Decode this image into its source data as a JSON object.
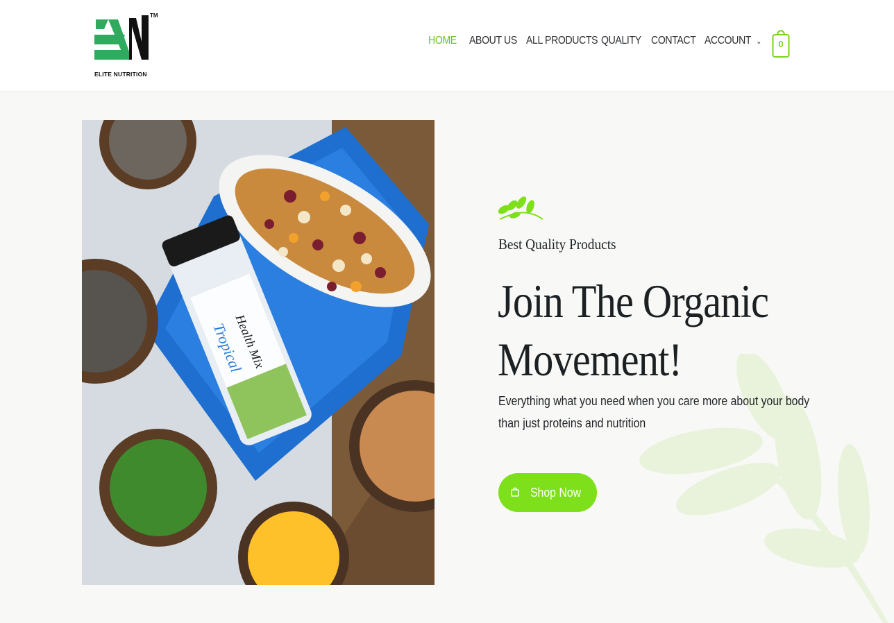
{
  "brand": {
    "name": "ELITE NUTRITION",
    "trademark": "TM",
    "colors": {
      "green": "#2faa5f",
      "dark": "#111111"
    }
  },
  "nav": {
    "items": [
      {
        "label": "HOME",
        "active": true
      },
      {
        "label": "ABOUT US"
      },
      {
        "label": "ALL PRODUCTS"
      },
      {
        "label": "QUALITY"
      },
      {
        "label": "CONTACT"
      },
      {
        "label": "ACCOUNT",
        "dropdown": true
      }
    ],
    "chevron": "⌄"
  },
  "cart": {
    "count": "0",
    "icon": "shopping-bag-icon"
  },
  "hero": {
    "eyebrow": "Best Quality Products",
    "headline_line1": "Join The Organic",
    "headline_line2": "Movement!",
    "description": "Everything what you need when you care more about your body than just proteins and nutrition",
    "button_label": "Shop Now",
    "button_icon": "cart-icon",
    "accent_color": "#7de01a"
  },
  "product_image": {
    "jar_label_line1": "Tropical",
    "jar_label_line2": "Health Mix"
  }
}
